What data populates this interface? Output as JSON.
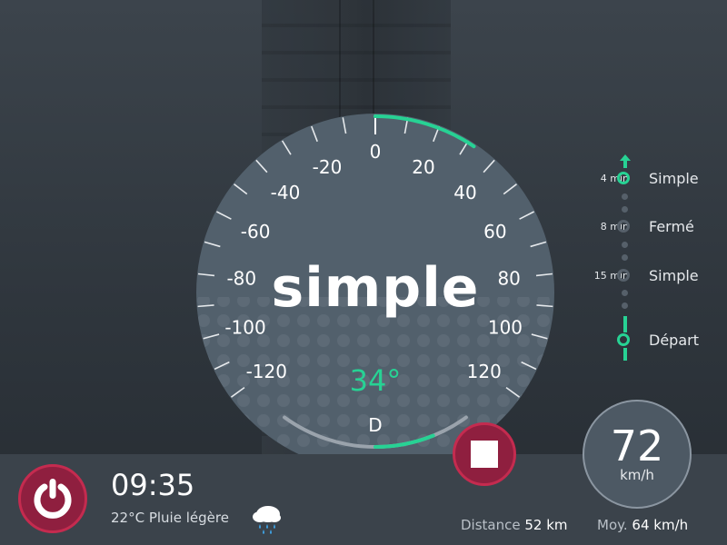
{
  "gauge": {
    "mode": "simple",
    "temperature": "34°",
    "gear": "D",
    "left_labels": [
      "-20",
      "-40",
      "-60",
      "-80",
      "-100",
      "-120"
    ],
    "right_labels": [
      "0",
      "20",
      "40",
      "60",
      "80",
      "100",
      "120"
    ],
    "accent_color": "#27d294"
  },
  "route": {
    "stops": [
      {
        "time": "4 min",
        "label": "Simple",
        "active": true
      },
      {
        "time": "8 min",
        "label": "Fermé",
        "active": false
      },
      {
        "time": "15 min",
        "label": "Simple",
        "active": false
      },
      {
        "time": "",
        "label": "Départ",
        "active": true
      }
    ]
  },
  "status": {
    "clock": "09:35",
    "weather": "22°C Pluie légère",
    "weather_icon": "rain-cloud-icon"
  },
  "speed": {
    "value": "72",
    "unit": "km/h"
  },
  "trip": {
    "distance_label": "Distance",
    "distance_value": "52 km",
    "average_label": "Moy.",
    "average_value": "64 km/h"
  },
  "icons": {
    "power": "power-icon",
    "stop": "stop-icon",
    "route_arrow": "arrow-up-icon"
  },
  "colors": {
    "accent": "#27d294",
    "alert": "#c42b4f",
    "panel": "#3b434b"
  }
}
